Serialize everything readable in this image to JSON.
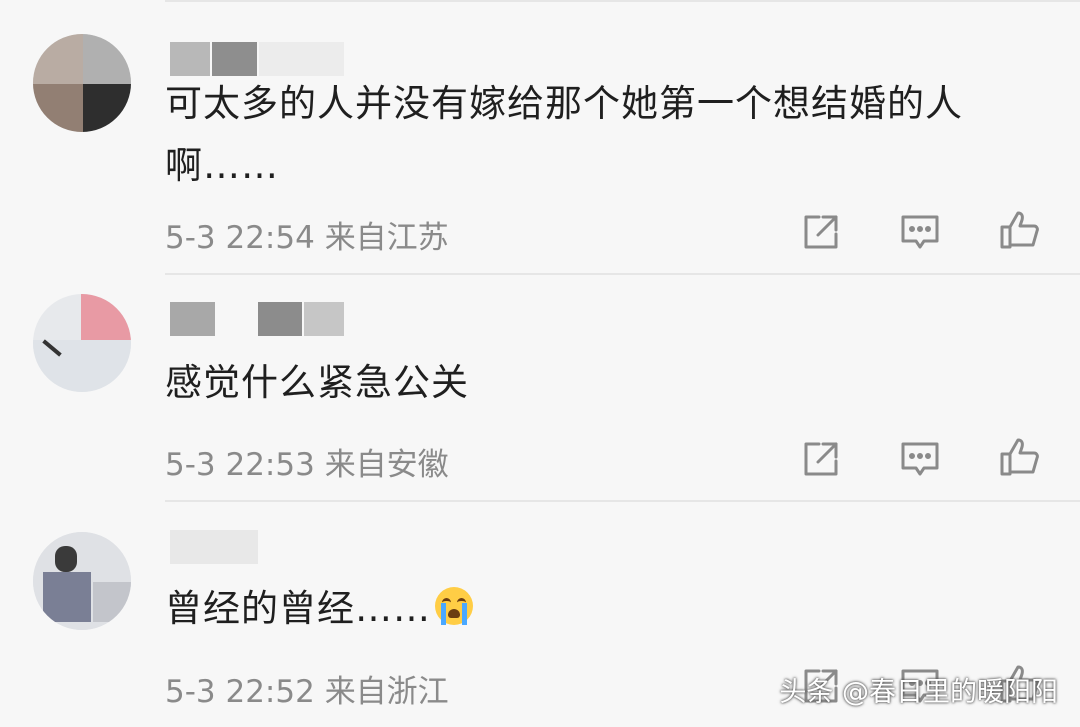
{
  "comments": [
    {
      "text": "可太多的人并没有嫁给那个她第一个想结婚的人啊……",
      "date": "5-3 22:54",
      "location": "来自江苏"
    },
    {
      "text": "感觉什么紧急公关",
      "date": "5-3 22:53",
      "location": "来自安徽"
    },
    {
      "text": "曾经的曾经……",
      "date": "5-3 22:52",
      "location": "来自浙江",
      "emoji": "crying-face-icon"
    }
  ],
  "actions": {
    "share": "share-icon",
    "reply": "comment-icon",
    "like": "thumbs-up-icon"
  },
  "colors": {
    "background": "#f7f7f7",
    "text": "#1f1f1f",
    "meta": "#8a8a8a",
    "icon": "#8a8a8a"
  },
  "watermark": "头条 @春日里的暖阳阳"
}
